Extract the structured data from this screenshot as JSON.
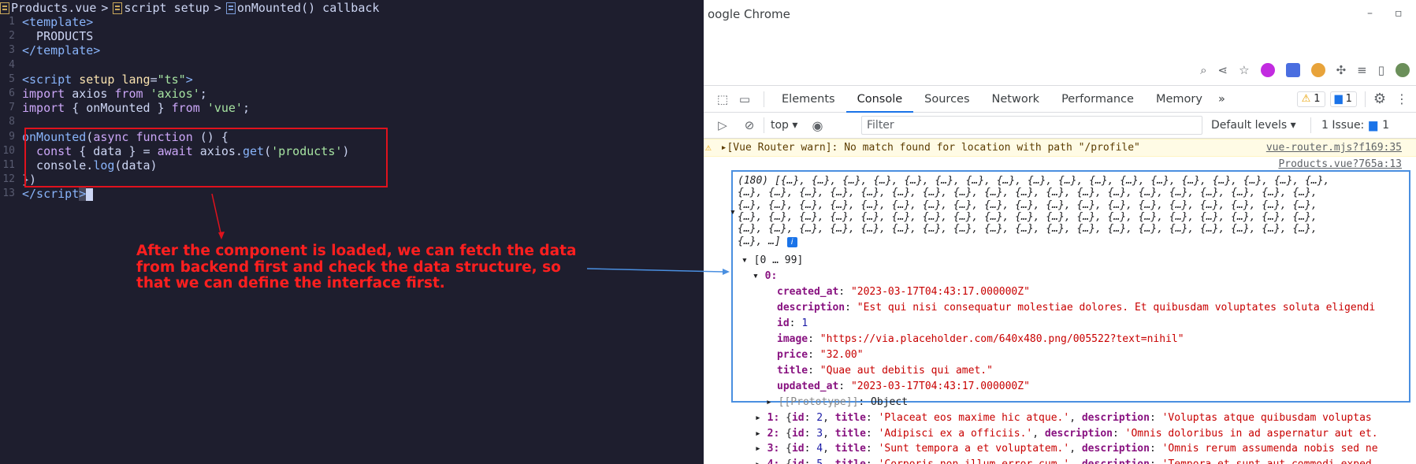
{
  "editor": {
    "breadcrumb": [
      "Products.vue",
      "script setup",
      "onMounted() callback"
    ],
    "lines": [
      {
        "n": "1",
        "html": "<span class='tg'>&lt;template&gt;</span>"
      },
      {
        "n": "2",
        "html": "<span class='pl'>  PRODUCTS</span>"
      },
      {
        "n": "3",
        "html": "<span class='tg'>&lt;/template&gt;</span>"
      },
      {
        "n": "4",
        "html": ""
      },
      {
        "n": "5",
        "html": "<span class='tg'>&lt;script</span> <span class='at'>setup</span> <span class='at'>lang</span><span class='pl'>=</span><span class='st'>\"ts\"</span><span class='tg'>&gt;</span>"
      },
      {
        "n": "6",
        "html": "<span class='kw'>import</span> <span class='pl'>axios</span> <span class='kw'>from</span> <span class='st'>'axios'</span><span class='pl'>;</span>"
      },
      {
        "n": "7",
        "html": "<span class='kw'>import</span> <span class='pl'>{ onMounted }</span> <span class='kw'>from</span> <span class='st'>'vue'</span><span class='pl'>;</span>"
      },
      {
        "n": "8",
        "html": ""
      },
      {
        "n": "9",
        "html": "<span class='fn'>onMounted</span><span class='pl'>(</span><span class='kw'>async</span> <span class='kw'>function</span> <span class='pl'>() {</span>"
      },
      {
        "n": "10",
        "html": "<span class='kw'>  const</span> <span class='pl'>{ data } = </span><span class='kw'>await</span> <span class='pl'>axios.</span><span class='fn'>get</span><span class='pl'>(</span><span class='st'>'products'</span><span class='pl'>)</span>"
      },
      {
        "n": "11",
        "html": "<span class='pl'>  console.</span><span class='fn'>log</span><span class='pl'>(data)</span>"
      },
      {
        "n": "12",
        "html": "<span class='pl'>})</span>"
      },
      {
        "n": "13",
        "html": "<span class='tg'>&lt;/script</span><span class='sel tg'>&gt;</span><span class='cursor'></span>"
      }
    ],
    "annotation": "After the component is loaded, we can fetch the data from backend first and check the data structure, so that we can define the interface first."
  },
  "chrome": {
    "window_title": "oogle Chrome",
    "tabs": [
      "Elements",
      "Console",
      "Sources",
      "Network",
      "Performance",
      "Memory"
    ],
    "more_tabs": "»",
    "warn_count": "1",
    "msg_count": "1",
    "context": "top",
    "filter_placeholder": "Filter",
    "levels": "Default levels",
    "issues": "1 Issue:",
    "issues_count": "1",
    "warn_text": "[Vue Router warn]: No match found for location with path \"/profile\"",
    "warn_src": "vue-router.mjs?f169:35",
    "log_src": "Products.vue?765a:13",
    "array_count": "(180)",
    "array_rows": [
      "[{…}, {…}, {…}, {…}, {…}, {…}, {…}, {…}, {…}, {…}, {…}, {…}, {…}, {…}, {…}, {…}, {…}, {…},",
      "{…}, {…}, {…}, {…}, {…}, {…}, {…}, {…}, {…}, {…}, {…}, {…}, {…}, {…}, {…}, {…}, {…}, {…}, {…},",
      "{…}, {…}, {…}, {…}, {…}, {…}, {…}, {…}, {…}, {…}, {…}, {…}, {…}, {…}, {…}, {…}, {…}, {…}, {…},",
      "{…}, {…}, {…}, {…}, {…}, {…}, {…}, {…}, {…}, {…}, {…}, {…}, {…}, {…}, {…}, {…}, {…}, {…}, {…},",
      "{…}, {…}, {…}, {…}, {…}, {…}, {…}, {…}, {…}, {…}, {…}, {…}, {…}, {…}, {…}, {…}, {…}, {…}, {…},",
      "{…}, …]"
    ],
    "range": "[0 … 99]",
    "item0_key": "0:",
    "fields": [
      {
        "k": "created_at",
        "v": "\"2023-03-17T04:43:17.000000Z\"",
        "t": "s"
      },
      {
        "k": "description",
        "v": "\"Est qui nisi consequatur molestiae dolores. Et quibusdam voluptates soluta eligendi",
        "t": "s"
      },
      {
        "k": "id",
        "v": "1",
        "t": "n"
      },
      {
        "k": "image",
        "v": "\"https://via.placeholder.com/640x480.png/005522?text=nihil\"",
        "t": "s"
      },
      {
        "k": "price",
        "v": "\"32.00\"",
        "t": "s"
      },
      {
        "k": "title",
        "v": "\"Quae aut debitis qui amet.\"",
        "t": "s"
      },
      {
        "k": "updated_at",
        "v": "\"2023-03-17T04:43:17.000000Z\"",
        "t": "s"
      }
    ],
    "prototype": "[[Prototype]]: Object",
    "items": [
      {
        "i": "1:",
        "id": "2",
        "title": "'Placeat eos maxime hic atque.'",
        "desc": "'Voluptas atque quibusdam voluptas"
      },
      {
        "i": "2:",
        "id": "3",
        "title": "'Adipisci ex a officiis.'",
        "desc": "'Omnis doloribus in ad aspernatur aut et."
      },
      {
        "i": "3:",
        "id": "4",
        "title": "'Sunt tempora a et voluptatem.'",
        "desc": "'Omnis rerum assumenda nobis sed ne"
      },
      {
        "i": "4:",
        "id": "5",
        "title": "'Corporis non illum error cum.'",
        "desc": "'Tempora et sunt aut commodi exped"
      }
    ]
  }
}
